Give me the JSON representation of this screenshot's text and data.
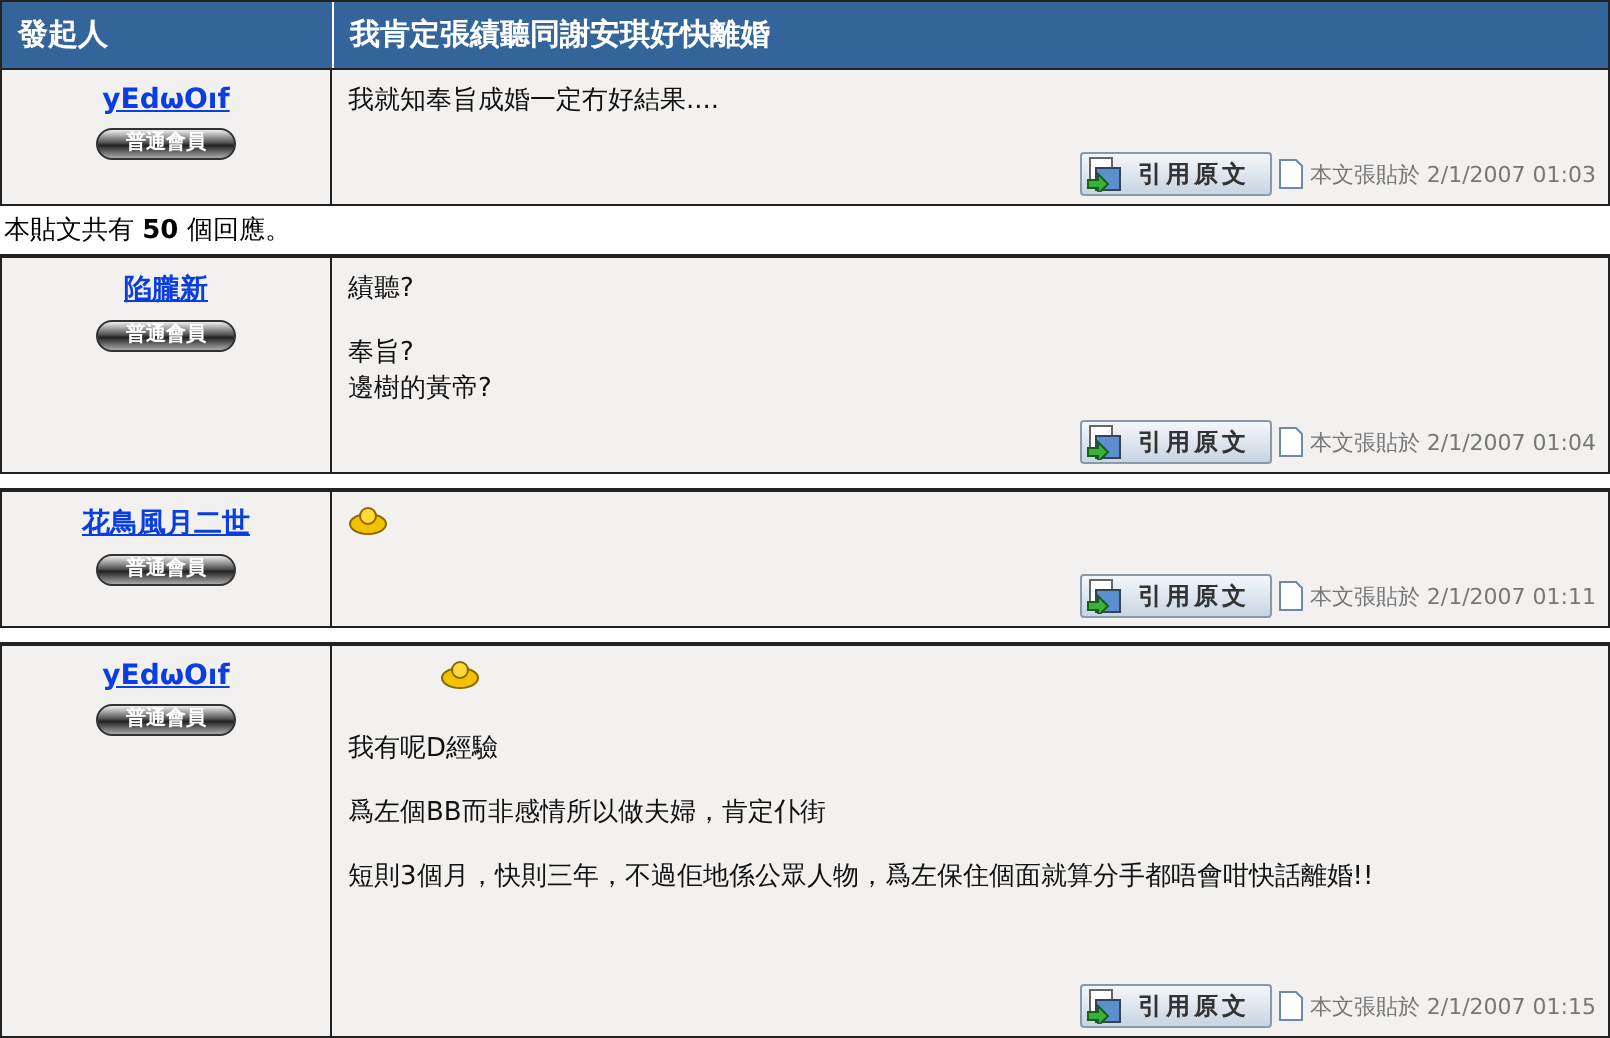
{
  "header": {
    "author_label": "發起人",
    "title": "我肯定張績聽同謝安琪好快離婚"
  },
  "posts": [
    {
      "author": "yEdωOıf",
      "rank": "普通會員",
      "body": [
        {
          "kind": "text",
          "text": "我就知奉旨成婚一定冇好結果...."
        }
      ],
      "quote_button": "引用原文",
      "posted": "本文張貼於 2/1/2007 01:03"
    },
    {
      "kind": "replies",
      "text": "本貼文共有 **50** 個回應。"
    },
    {
      "author": "陷朧新",
      "rank": "普通會員",
      "body": [
        {
          "kind": "text",
          "text": "績聽?"
        },
        {
          "kind": "gap"
        },
        {
          "kind": "text",
          "text": "奉旨?"
        },
        {
          "kind": "text",
          "text": "邊樹的黃帝?"
        }
      ],
      "quote_button": "引用原文",
      "posted": "本文張貼於 2/1/2007 01:04"
    },
    {
      "author": "花鳥風月二世",
      "rank": "普通會員",
      "body": [
        {
          "kind": "emoticon"
        }
      ],
      "quote_button": "引用原文",
      "posted": "本文張貼於 2/1/2007 01:11"
    },
    {
      "author": "yEdωOıf",
      "rank": "普通會員",
      "body": [
        {
          "kind": "indented_emoticon"
        },
        {
          "kind": "gap"
        },
        {
          "kind": "text",
          "text": "我有呢D經驗"
        },
        {
          "kind": "gap"
        },
        {
          "kind": "text",
          "text": "爲左個BB而非感情所以做夫婦，肯定仆街"
        },
        {
          "kind": "gap"
        },
        {
          "kind": "text",
          "text": "短則3個月，快則三年，不過佢地係公眾人物，爲左保住個面就算分手都唔會咁快話離婚!!"
        }
      ],
      "quote_button": "引用原文",
      "posted": "本文張貼於 2/1/2007 01:15"
    }
  ]
}
